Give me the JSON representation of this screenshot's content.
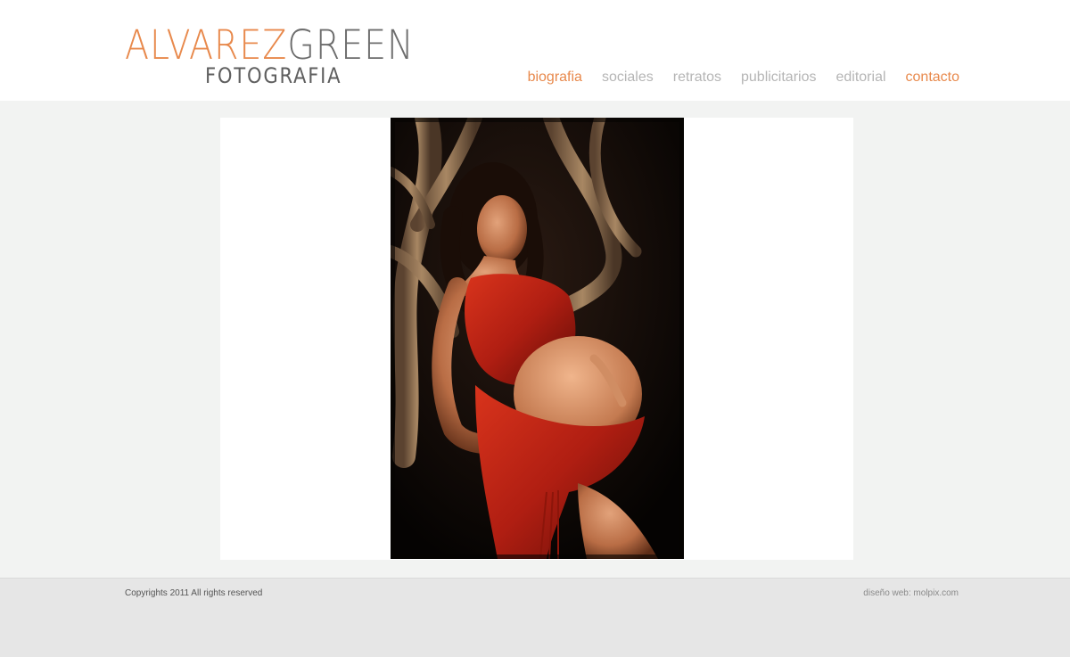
{
  "header": {
    "logo": {
      "line1_part1": "ALVAREZ",
      "line1_part2": "GREEN",
      "line2": "FOTOGRAFIA"
    },
    "nav": [
      {
        "label": "biografia",
        "accent": true
      },
      {
        "label": "sociales",
        "accent": false
      },
      {
        "label": "retratos",
        "accent": false
      },
      {
        "label": "publicitarios",
        "accent": false
      },
      {
        "label": "editorial",
        "accent": false
      },
      {
        "label": "contacto",
        "accent": true
      }
    ]
  },
  "footer": {
    "copyright": "Copyrights 2011 All rights reserved",
    "credit": "diseño web: molpix.com"
  },
  "colors": {
    "accent": "#e8894c",
    "nav_inactive": "#b5b5b5",
    "page_bg": "#f2f3f2",
    "footer_bg": "#e6e6e6",
    "dress": "#b01e12"
  }
}
